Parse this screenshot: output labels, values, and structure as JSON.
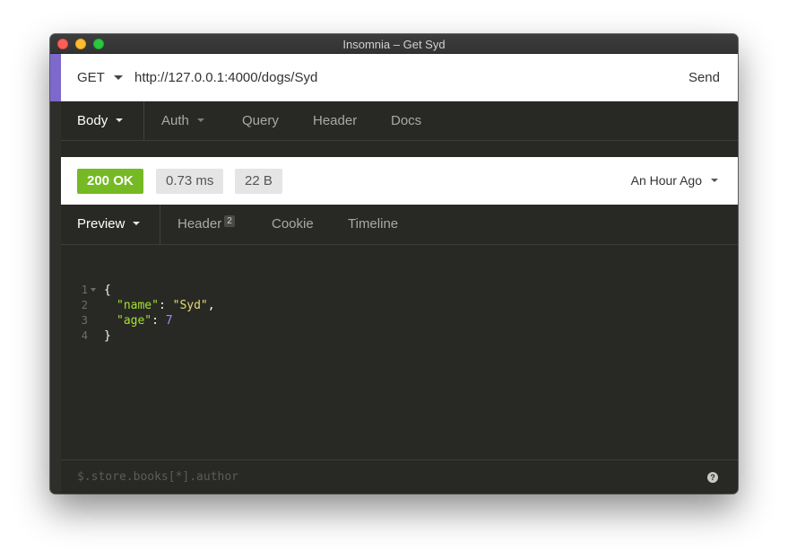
{
  "window": {
    "title": "Insomnia – Get Syd"
  },
  "request": {
    "method": "GET",
    "url": "http://127.0.0.1:4000/dogs/Syd",
    "send_label": "Send"
  },
  "request_tabs": [
    {
      "label": "Body"
    },
    {
      "label": "Auth"
    },
    {
      "label": "Query"
    },
    {
      "label": "Header"
    },
    {
      "label": "Docs"
    }
  ],
  "response": {
    "status": "200 OK",
    "time": "0.73 ms",
    "size": "22 B",
    "history_label": "An Hour Ago"
  },
  "response_tabs": [
    {
      "label": "Preview"
    },
    {
      "label": "Header",
      "count": "2"
    },
    {
      "label": "Cookie"
    },
    {
      "label": "Timeline"
    }
  ],
  "code": {
    "line_numbers": [
      "1",
      "2",
      "3",
      "4"
    ],
    "open_brace": "{",
    "name_key": "\"name\"",
    "name_value": "\"Syd\"",
    "age_key": "\"age\"",
    "age_value": "7",
    "close_brace": "}"
  },
  "filter": {
    "placeholder": "$.store.books[*].author"
  },
  "colors": {
    "accent": "#7d69cb",
    "status_ok": "#75ba24",
    "json_key": "#a6e22e",
    "json_string": "#e6db74",
    "json_number": "#ae81ff"
  }
}
